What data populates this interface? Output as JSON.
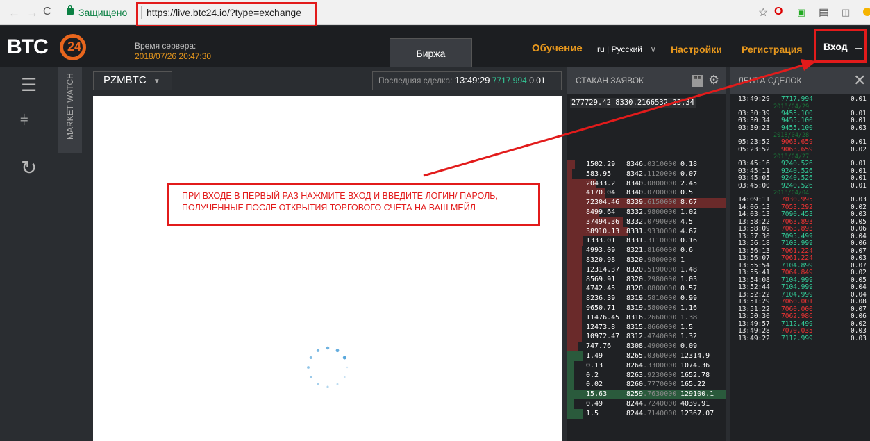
{
  "browser": {
    "back": "←",
    "forward": "→",
    "reload": "C",
    "secure_label": "Защищено",
    "url": "https://live.btc24.io/?type=exchange",
    "icons": [
      "star-icon",
      "opera-icon",
      "translate-icon",
      "briefcase-icon",
      "extension-icon"
    ]
  },
  "header": {
    "logo_text": "BTC",
    "logo_badge": "24",
    "server_time_label": "Время сервера:",
    "server_time": "2018/07/26 20:47:30",
    "tab_exchange": "Биржа",
    "learning": "Обучение",
    "language": "ru | Русский",
    "settings": "Настройки",
    "register": "Регистрация",
    "login": "Вход"
  },
  "sidebar": {
    "market_watch": "MARKET WATCH"
  },
  "toolbar": {
    "pair": "PZMBTC",
    "last_trade_label": "Последняя сделка:",
    "last_trade_time": "13:49:29",
    "last_trade_price": "7717.994",
    "last_trade_qty": "0.01"
  },
  "orderbook": {
    "title": "СТАКАН ЗАЯВОК",
    "top_row": "277729.42 8330.2166532 33.34",
    "rows": [
      {
        "amount": "1502.29",
        "p1": "8346",
        "p2": ".0310000",
        "vol": "0.18",
        "side": "sell",
        "depth": 0.05
      },
      {
        "amount": "583.95",
        "p1": "8342",
        "p2": ".1120000",
        "vol": "0.07",
        "side": "sell",
        "depth": 0.03
      },
      {
        "amount": "20433.2",
        "p1": "8340",
        "p2": ".0800000",
        "vol": "2.45",
        "side": "sell",
        "depth": 0.18
      },
      {
        "amount": "4170.04",
        "p1": "8340",
        "p2": ".0700000",
        "vol": "0.5",
        "side": "sell",
        "depth": 0.24
      },
      {
        "amount": "72304.46",
        "p1": "8339",
        "p2": ".6150000",
        "vol": "8.67",
        "side": "sell",
        "depth": 1.0
      },
      {
        "amount": "8499.64",
        "p1": "8332",
        "p2": ".9800000",
        "vol": "1.02",
        "side": "sell",
        "depth": 0.2
      },
      {
        "amount": "37494.36",
        "p1": "8332",
        "p2": ".0790000",
        "vol": "4.5",
        "side": "sell",
        "depth": 0.35
      },
      {
        "amount": "38910.13",
        "p1": "8331",
        "p2": ".9330000",
        "vol": "4.67",
        "side": "sell",
        "depth": 0.38
      },
      {
        "amount": "1333.01",
        "p1": "8331",
        "p2": ".3110000",
        "vol": "0.16",
        "side": "sell",
        "depth": 0.1
      },
      {
        "amount": "4993.09",
        "p1": "8321",
        "p2": ".8160000",
        "vol": "0.6",
        "side": "sell",
        "depth": 0.09
      },
      {
        "amount": "8320.98",
        "p1": "8320",
        "p2": ".9800000",
        "vol": "1",
        "side": "sell",
        "depth": 0.09
      },
      {
        "amount": "12314.37",
        "p1": "8320",
        "p2": ".5190000",
        "vol": "1.48",
        "side": "sell",
        "depth": 0.09
      },
      {
        "amount": "8569.91",
        "p1": "8320",
        "p2": ".2980000",
        "vol": "1.03",
        "side": "sell",
        "depth": 0.09
      },
      {
        "amount": "4742.45",
        "p1": "8320",
        "p2": ".0800000",
        "vol": "0.57",
        "side": "sell",
        "depth": 0.09
      },
      {
        "amount": "8236.39",
        "p1": "8319",
        "p2": ".5810000",
        "vol": "0.99",
        "side": "sell",
        "depth": 0.09
      },
      {
        "amount": "9650.71",
        "p1": "8319",
        "p2": ".5800000",
        "vol": "1.16",
        "side": "sell",
        "depth": 0.09
      },
      {
        "amount": "11476.45",
        "p1": "8316",
        "p2": ".2660000",
        "vol": "1.38",
        "side": "sell",
        "depth": 0.09
      },
      {
        "amount": "12473.8",
        "p1": "8315",
        "p2": ".8660000",
        "vol": "1.5",
        "side": "sell",
        "depth": 0.09
      },
      {
        "amount": "10972.47",
        "p1": "8312",
        "p2": ".4740000",
        "vol": "1.32",
        "side": "sell",
        "depth": 0.09
      },
      {
        "amount": "747.76",
        "p1": "8308",
        "p2": ".4900000",
        "vol": "0.09",
        "side": "sell",
        "depth": 0.07
      },
      {
        "amount": "1.49",
        "p1": "8265",
        "p2": ".0360000",
        "vol": "12314.9",
        "side": "buy",
        "depth": 0.1
      },
      {
        "amount": "0.13",
        "p1": "8264",
        "p2": ".3300000",
        "vol": "1074.36",
        "side": "buy",
        "depth": 0.04
      },
      {
        "amount": "0.2",
        "p1": "8263",
        "p2": ".9230000",
        "vol": "1652.78",
        "side": "buy",
        "depth": 0.04
      },
      {
        "amount": "0.02",
        "p1": "8260",
        "p2": ".7770000",
        "vol": "165.22",
        "side": "buy",
        "depth": 0.04
      },
      {
        "amount": "15.63",
        "p1": "8259",
        "p2": ".7630000",
        "vol": "129100.1",
        "side": "buy",
        "depth": 1.0
      },
      {
        "amount": "0.49",
        "p1": "8244",
        "p2": ".7240000",
        "vol": "4039.91",
        "side": "buy",
        "depth": 0.04
      },
      {
        "amount": "1.5",
        "p1": "8244",
        "p2": ".7140000",
        "vol": "12367.07",
        "side": "buy",
        "depth": 0.1
      }
    ]
  },
  "trades": {
    "title": "ЛЕНТА СДЕЛОК",
    "items": [
      {
        "time": "13:49:29",
        "price": "7717.994",
        "qty": "0.01",
        "dir": "up"
      },
      {
        "date": "2018/04/29"
      },
      {
        "time": "03:30:39",
        "price": "9455.100",
        "qty": "0.01",
        "dir": "up"
      },
      {
        "time": "03:30:34",
        "price": "9455.100",
        "qty": "0.01",
        "dir": "up"
      },
      {
        "time": "03:30:23",
        "price": "9455.100",
        "qty": "0.03",
        "dir": "up"
      },
      {
        "date": "2018/04/28"
      },
      {
        "time": "05:23:52",
        "price": "9063.659",
        "qty": "0.01",
        "dir": "down"
      },
      {
        "time": "05:23:52",
        "price": "9063.659",
        "qty": "0.02",
        "dir": "down"
      },
      {
        "date": "2018/04/27"
      },
      {
        "time": "03:45:16",
        "price": "9240.526",
        "qty": "0.01",
        "dir": "up"
      },
      {
        "time": "03:45:11",
        "price": "9240.526",
        "qty": "0.01",
        "dir": "up"
      },
      {
        "time": "03:45:05",
        "price": "9240.526",
        "qty": "0.01",
        "dir": "up"
      },
      {
        "time": "03:45:00",
        "price": "9240.526",
        "qty": "0.01",
        "dir": "up"
      },
      {
        "date": "2018/04/04"
      },
      {
        "time": "14:09:11",
        "price": "7030.995",
        "qty": "0.03",
        "dir": "down"
      },
      {
        "time": "14:06:13",
        "price": "7053.292",
        "qty": "0.02",
        "dir": "down"
      },
      {
        "time": "14:03:13",
        "price": "7090.453",
        "qty": "0.03",
        "dir": "up"
      },
      {
        "time": "13:58:22",
        "price": "7063.893",
        "qty": "0.05",
        "dir": "down"
      },
      {
        "time": "13:58:09",
        "price": "7063.893",
        "qty": "0.06",
        "dir": "down"
      },
      {
        "time": "13:57:30",
        "price": "7095.499",
        "qty": "0.04",
        "dir": "up"
      },
      {
        "time": "13:56:18",
        "price": "7103.999",
        "qty": "0.06",
        "dir": "up"
      },
      {
        "time": "13:56:13",
        "price": "7061.224",
        "qty": "0.07",
        "dir": "down"
      },
      {
        "time": "13:56:07",
        "price": "7061.224",
        "qty": "0.03",
        "dir": "down"
      },
      {
        "time": "13:55:54",
        "price": "7104.899",
        "qty": "0.07",
        "dir": "up"
      },
      {
        "time": "13:55:41",
        "price": "7064.849",
        "qty": "0.02",
        "dir": "down"
      },
      {
        "time": "13:54:08",
        "price": "7104.999",
        "qty": "0.05",
        "dir": "up"
      },
      {
        "time": "13:52:44",
        "price": "7104.999",
        "qty": "0.04",
        "dir": "up"
      },
      {
        "time": "13:52:22",
        "price": "7104.999",
        "qty": "0.04",
        "dir": "up"
      },
      {
        "time": "13:51:29",
        "price": "7060.001",
        "qty": "0.08",
        "dir": "down"
      },
      {
        "time": "13:51:22",
        "price": "7060.000",
        "qty": "0.07",
        "dir": "down"
      },
      {
        "time": "13:50:30",
        "price": "7062.986",
        "qty": "0.06",
        "dir": "down"
      },
      {
        "time": "13:49:57",
        "price": "7112.499",
        "qty": "0.02",
        "dir": "up"
      },
      {
        "time": "13:49:28",
        "price": "7070.035",
        "qty": "0.03",
        "dir": "down"
      },
      {
        "time": "13:49:22",
        "price": "7112.999",
        "qty": "0.03",
        "dir": "up"
      }
    ]
  },
  "annotation": {
    "line1": "ПРИ ВХОДЕ В ПЕРВЫЙ РАЗ НАЖМИТЕ ВХОД И ВВЕДИТЕ ЛОГИН/ ПАРОЛЬ,",
    "line2": "ПОЛУЧЕННЫЕ ПОСЛЕ ОТКРЫТИЯ ТОРГОВОГО СЧЁТА НА ВАШ МЕЙЛ"
  },
  "colors": {
    "accent": "#e8981d",
    "buy": "#3c9",
    "sell": "#e33",
    "annotation": "#e21b1b"
  }
}
